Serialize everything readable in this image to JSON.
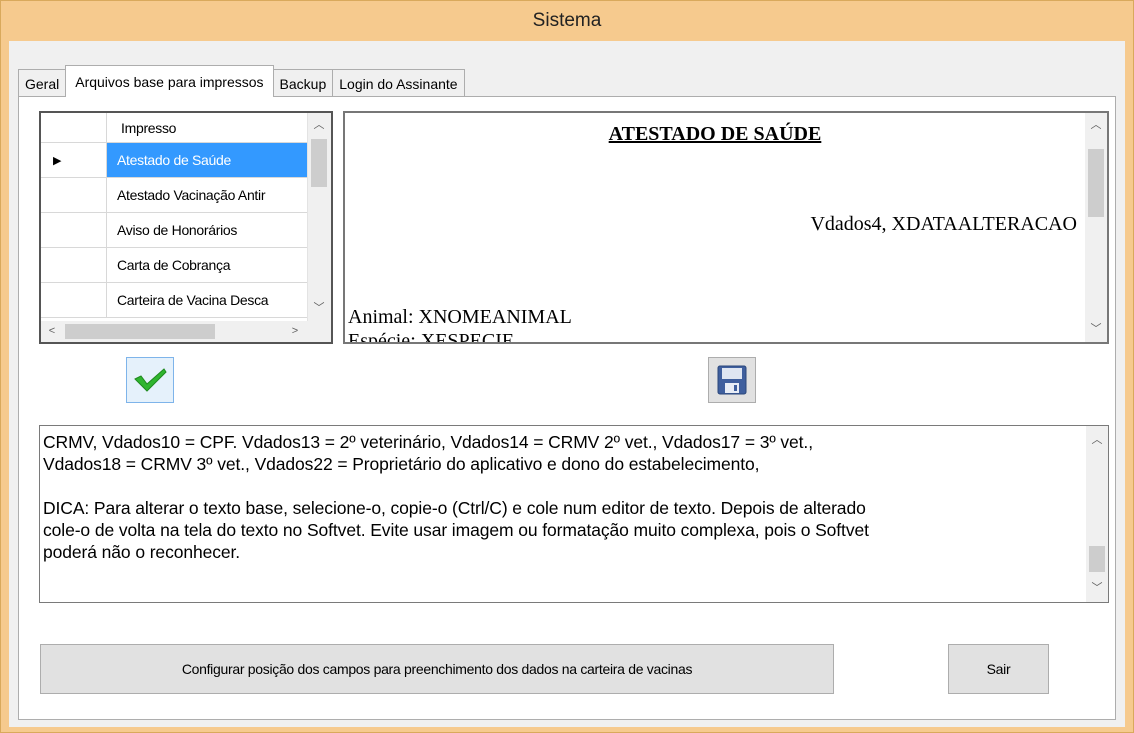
{
  "window": {
    "title": "Sistema"
  },
  "tabs": [
    {
      "label": "Geral",
      "active": false
    },
    {
      "label": "Arquivos base para impressos",
      "active": true
    },
    {
      "label": "Backup",
      "active": false
    },
    {
      "label": "Login do Assinante",
      "active": false
    }
  ],
  "grid": {
    "header": "Impresso",
    "current_row_marker": "▶",
    "rows": [
      "Atestado de Saúde",
      "Atestado Vacinação Antir",
      "Aviso de Honorários",
      "Carta de Cobrança",
      "Carteira de Vacina Desca"
    ],
    "selected_index": 0
  },
  "preview": {
    "title": "ATESTADO DE SAÚDE",
    "date_line": "Vdados4, XDATAALTERACAO",
    "animal_line": "Animal: XNOMEANIMAL",
    "cut_line": "Espécie: XESPECIE"
  },
  "notes": {
    "text": "CRMV, Vdados10 = CPF. Vdados13 = 2º veterinário, Vdados14 = CRMV 2º vet., Vdados17 = 3º vet.,\nVdados18 = CRMV 3º vet., Vdados22 = Proprietário do aplicativo e dono do estabelecimento,\n\nDICA: Para alterar o texto base, selecione-o, copie-o (Ctrl/C) e cole num editor de texto. Depois de alterado\ncole-o de volta na tela do texto no Softvet. Evite usar imagem ou formatação muito complexa, pois o Softvet\npoderá não o reconhecer."
  },
  "buttons": {
    "apply_icon": "checkmark-icon",
    "save_icon": "floppy-disk-icon",
    "config_label": "Configurar posição dos campos para preenchimento dos dados na carteira de vacinas",
    "exit_label": "Sair"
  },
  "colors": {
    "title_bar": "#f6ca8e",
    "selection": "#3399ff",
    "check_green": "#2fb52f"
  }
}
